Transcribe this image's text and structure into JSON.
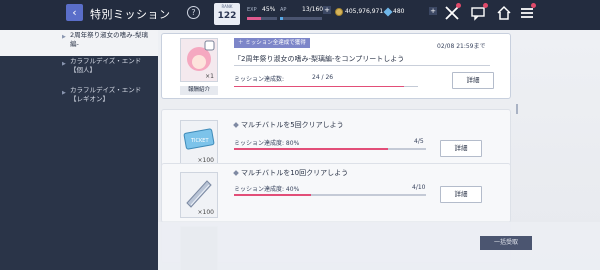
{
  "header": {
    "title": "特別ミッション",
    "back_icon": "‹",
    "help_icon": "?",
    "rank_label": "RANK",
    "rank_value": "122",
    "exp_label": "EXP",
    "exp_value": "45%",
    "ap_label": "AP",
    "ap_value": "13/160",
    "ap_plus": "+",
    "coins": "405,976,971",
    "gems": "480",
    "gem_plus": "+",
    "exp_progress": 0.45,
    "ap_progress": 0.08
  },
  "sidebar": {
    "items": [
      {
        "label": "2周年祭り淑女の嗜み-梨璃編-",
        "active": true
      },
      {
        "label": "カラフルデイズ・エンド【個人】",
        "active": false
      },
      {
        "label": "カラフルデイズ・エンド【レギオン】",
        "active": false
      }
    ]
  },
  "featured": {
    "badge": "ミッション全達成で獲得",
    "deadline": "02/08 21:59まで",
    "title": "「2周年祭り淑女の嗜み-梨璃編-をコンプリートしよう",
    "progress_label": "ミッション達成数:",
    "progress_value": "24 / 26",
    "progress_fraction": 0.923,
    "detail_label": "詳細",
    "reward_count": "×1",
    "reward_tag": "報酬紹介"
  },
  "missions": [
    {
      "title": "マルチバトルを5回クリアしよう",
      "progress_label": "ミッション達成度: 80%",
      "progress_ratio": "4/5",
      "progress_fraction": 0.8,
      "detail_label": "詳細",
      "reward_count": "×100",
      "reward_icon": "ticket-icon"
    },
    {
      "title": "マルチバトルを10回クリアしよう",
      "progress_label": "ミッション達成度: 40%",
      "progress_ratio": "4/10",
      "progress_fraction": 0.4,
      "detail_label": "詳細",
      "reward_count": "×100",
      "reward_icon": "crystal-icon"
    }
  ],
  "claim_all_label": "一括受取",
  "colors": {
    "accent": "#e24e78",
    "header_bg": "#232c3f",
    "sidebar_bg": "#2a3448"
  }
}
